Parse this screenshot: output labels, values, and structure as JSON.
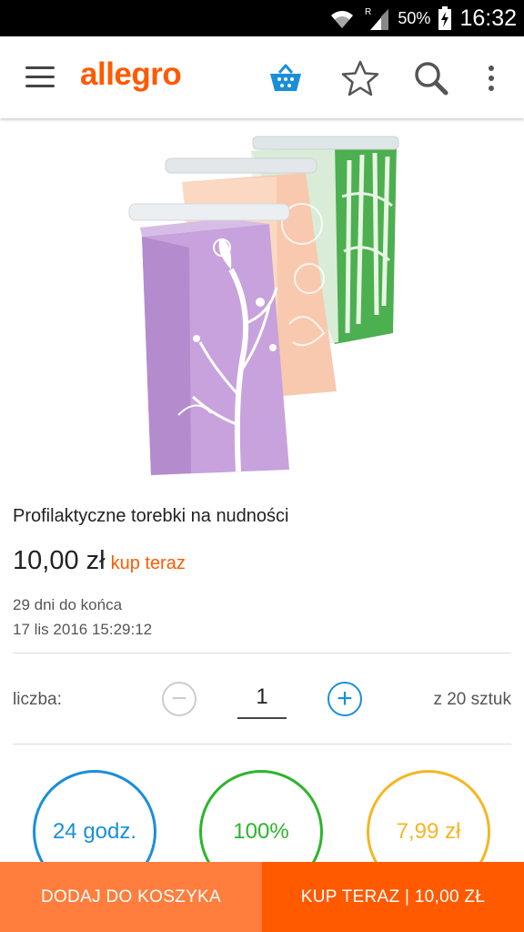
{
  "status_bar": {
    "battery_percent": "50%",
    "time": "16:32",
    "roaming_indicator": "R"
  },
  "app_bar": {
    "logo_text": "allegro",
    "icons": [
      "menu-icon",
      "cart-icon",
      "star-icon",
      "search-icon",
      "overflow-icon"
    ]
  },
  "product": {
    "title": "Profilaktyczne torebki na nudności",
    "price": "10,00 zł",
    "buy_now_label": "kup teraz",
    "time_left": "29 dni do końca",
    "end_date": "17 lis 2016 15:29:12"
  },
  "quantity": {
    "label": "liczba:",
    "minus_symbol": "−",
    "plus_symbol": "+",
    "value": "1",
    "available": "z 20 sztuk"
  },
  "badges": [
    {
      "text": "24 godz.",
      "color": "#1a8fd8"
    },
    {
      "text": "100%",
      "color": "#2cb52c"
    },
    {
      "text": "7,99 zł",
      "color": "#f5b623"
    }
  ],
  "bottom_bar": {
    "add_to_cart_label": "DODAJ DO KOSZYKA",
    "buy_now_label": "KUP TERAZ | 10,00 ZŁ"
  },
  "colors": {
    "brand_orange": "#ff5a00",
    "cart_button": "#ff7e3d",
    "accent_blue": "#1a8fd8"
  }
}
